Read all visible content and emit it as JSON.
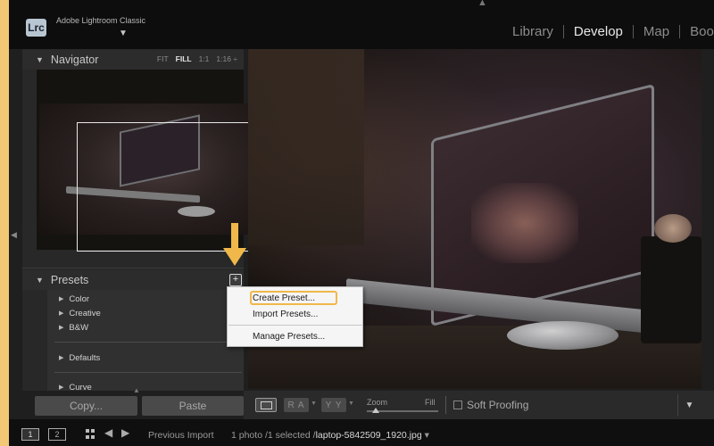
{
  "app": {
    "logo": "Lrc",
    "name": "Adobe Lightroom Classic"
  },
  "modules": [
    {
      "label": "Library",
      "active": false
    },
    {
      "label": "Develop",
      "active": true
    },
    {
      "label": "Map",
      "active": false
    },
    {
      "label": "Boo",
      "active": false
    }
  ],
  "navigator": {
    "title": "Navigator",
    "zoom_options": [
      "FIT",
      "FILL",
      "1:1",
      "1:16 ÷"
    ],
    "zoom_selected": "FILL"
  },
  "presets": {
    "title": "Presets",
    "add_symbol": "+",
    "groups": [
      "Color",
      "Creative",
      "B&W",
      "Defaults",
      "Curve"
    ]
  },
  "context_menu": {
    "items": [
      "Create Preset...",
      "Import Presets...",
      "Manage Presets..."
    ],
    "highlighted": "Create Preset..."
  },
  "buttons": {
    "copy": "Copy...",
    "paste": "Paste"
  },
  "toolbar": {
    "ra_label": "R A",
    "yy_label": "Y Y",
    "zoom_label": "Zoom",
    "fill_label": "Fill",
    "soft_proofing": "Soft Proofing"
  },
  "filmstrip": {
    "screen1": "1",
    "screen2": "2",
    "source": "Previous Import",
    "count": "1 photo /1 selected /",
    "filename": "laptop-5842509_1920.jpg"
  },
  "colors": {
    "frame": "#f2c877",
    "annotation": "#f0b84a",
    "active_module": "#e8e8e8"
  }
}
